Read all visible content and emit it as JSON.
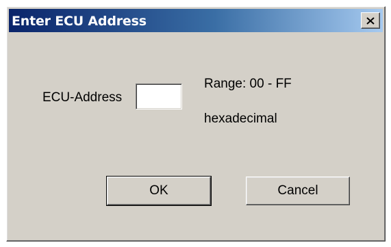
{
  "dialog": {
    "title": "Enter ECU Address",
    "close_icon": "close-icon"
  },
  "form": {
    "address_label": "ECU-Address",
    "address_value": "",
    "range_text": "Range: 00 - FF",
    "format_text": "hexadecimal"
  },
  "buttons": {
    "ok_label": "OK",
    "cancel_label": "Cancel"
  },
  "colors": {
    "titlebar_start": "#0a246a",
    "titlebar_end": "#a6caf0",
    "dialog_face": "#d4d0c8"
  }
}
